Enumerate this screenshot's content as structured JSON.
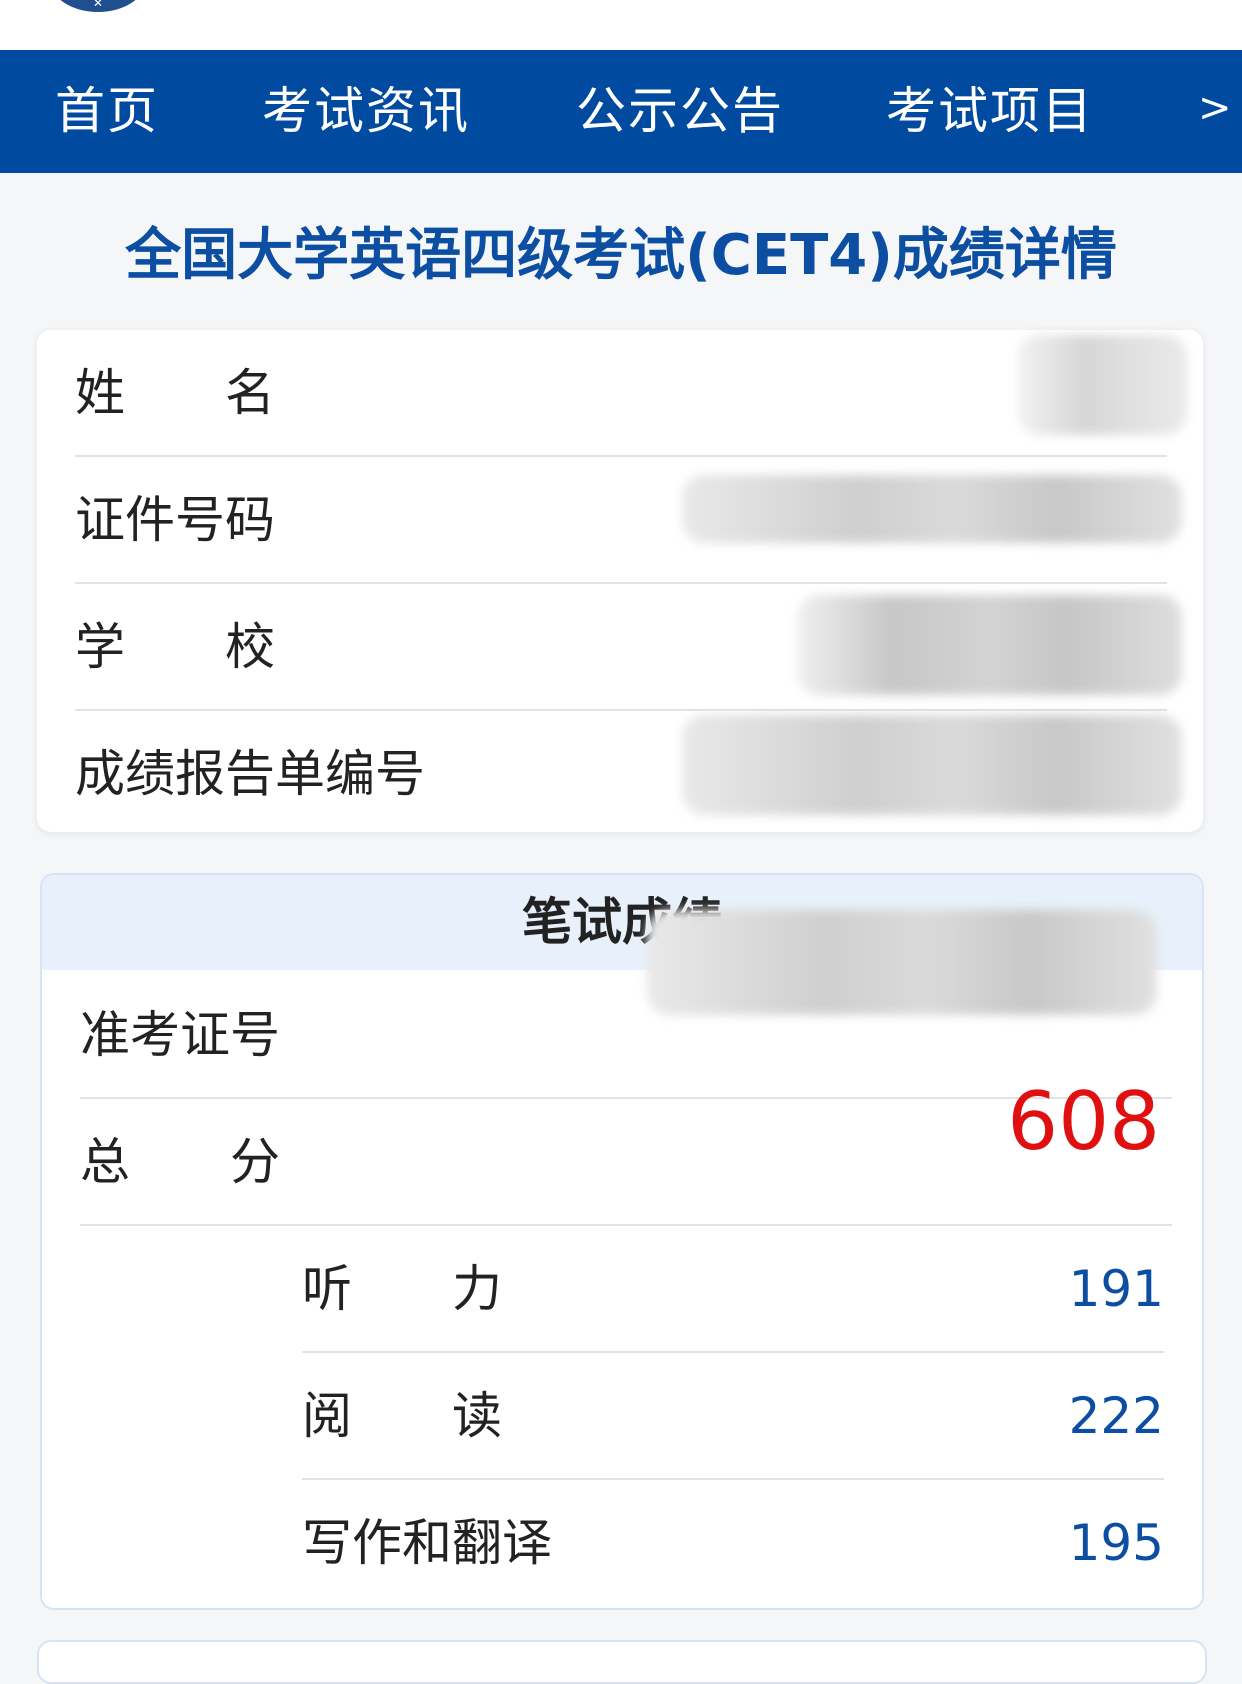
{
  "nav": {
    "items": [
      "首页",
      "考试资讯",
      "公示公告",
      "考试项目"
    ],
    "more_icon": ">"
  },
  "page_title": "全国大学英语四级考试(CET4)成绩详情",
  "info": {
    "name_label": "姓　　名",
    "id_label": "证件号码",
    "school_label": "学　　校",
    "report_label": "成绩报告单编号"
  },
  "written": {
    "header": "笔试成绩",
    "ticket_label": "准考证号",
    "total_label": "总　　分",
    "total_score": "608",
    "listening_label": "听　　力",
    "listening_score": "191",
    "reading_label": "阅　　读",
    "reading_score": "222",
    "writing_label": "写作和翻译",
    "writing_score": "195"
  },
  "colors": {
    "nav_bg": "#004ba0",
    "title": "#0b4ea2",
    "total_score": "#e01010",
    "sub_score": "#0b4ea2"
  }
}
